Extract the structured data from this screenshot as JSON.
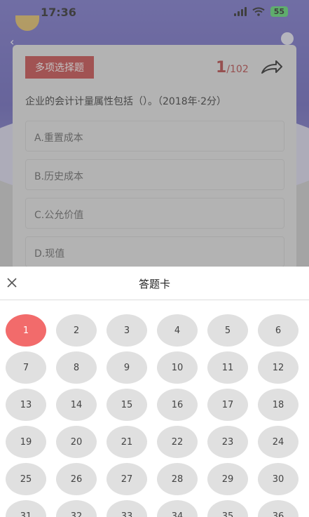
{
  "status": {
    "time": "17:36",
    "battery": "55"
  },
  "question": {
    "type_label": "多项选择题",
    "current": "1",
    "total": "/102",
    "text": "企业的会计计量属性包括（）。（2018年·2分）",
    "options": [
      "A.重置成本",
      "B.历史成本",
      "C.公允价值",
      "D.现值"
    ]
  },
  "answer_sheet": {
    "title": "答题卡",
    "active": "1",
    "numbers": [
      "1",
      "2",
      "3",
      "4",
      "5",
      "6",
      "7",
      "8",
      "9",
      "10",
      "11",
      "12",
      "13",
      "14",
      "15",
      "16",
      "17",
      "18",
      "19",
      "20",
      "21",
      "22",
      "23",
      "24",
      "25",
      "26",
      "27",
      "28",
      "29",
      "30",
      "31",
      "32",
      "33",
      "34",
      "35",
      "36"
    ]
  },
  "colors": {
    "accent": "#c43535",
    "active_cell": "#f26b6b",
    "cell": "#e0e0e0"
  }
}
